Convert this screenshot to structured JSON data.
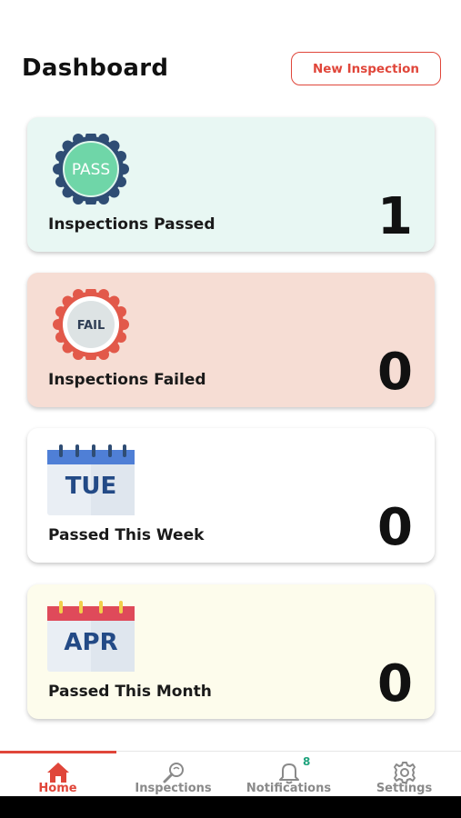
{
  "header": {
    "title": "Dashboard",
    "new_button": "New Inspection"
  },
  "cards": [
    {
      "label": "Inspections Passed",
      "value": "1",
      "icon_text": "PASS",
      "icon": "pass-badge-icon"
    },
    {
      "label": "Inspections Failed",
      "value": "0",
      "icon_text": "FAIL",
      "icon": "fail-badge-icon"
    },
    {
      "label": "Passed This Week",
      "value": "0",
      "icon_text": "TUE",
      "icon": "calendar-icon"
    },
    {
      "label": "Passed This Month",
      "value": "0",
      "icon_text": "APR",
      "icon": "calendar-icon"
    }
  ],
  "nav": {
    "items": [
      {
        "label": "Home",
        "icon": "home-icon",
        "active": true
      },
      {
        "label": "Inspections",
        "icon": "magnifier-icon"
      },
      {
        "label": "Notifications",
        "icon": "bell-icon",
        "badge": "8"
      },
      {
        "label": "Settings",
        "icon": "gear-icon"
      }
    ]
  },
  "colors": {
    "accent": "#e0463a",
    "pass_card": "#e8f7f3",
    "fail_card": "#f6ddd4",
    "month_card": "#fdfcec",
    "badge": "#1fa37d"
  }
}
